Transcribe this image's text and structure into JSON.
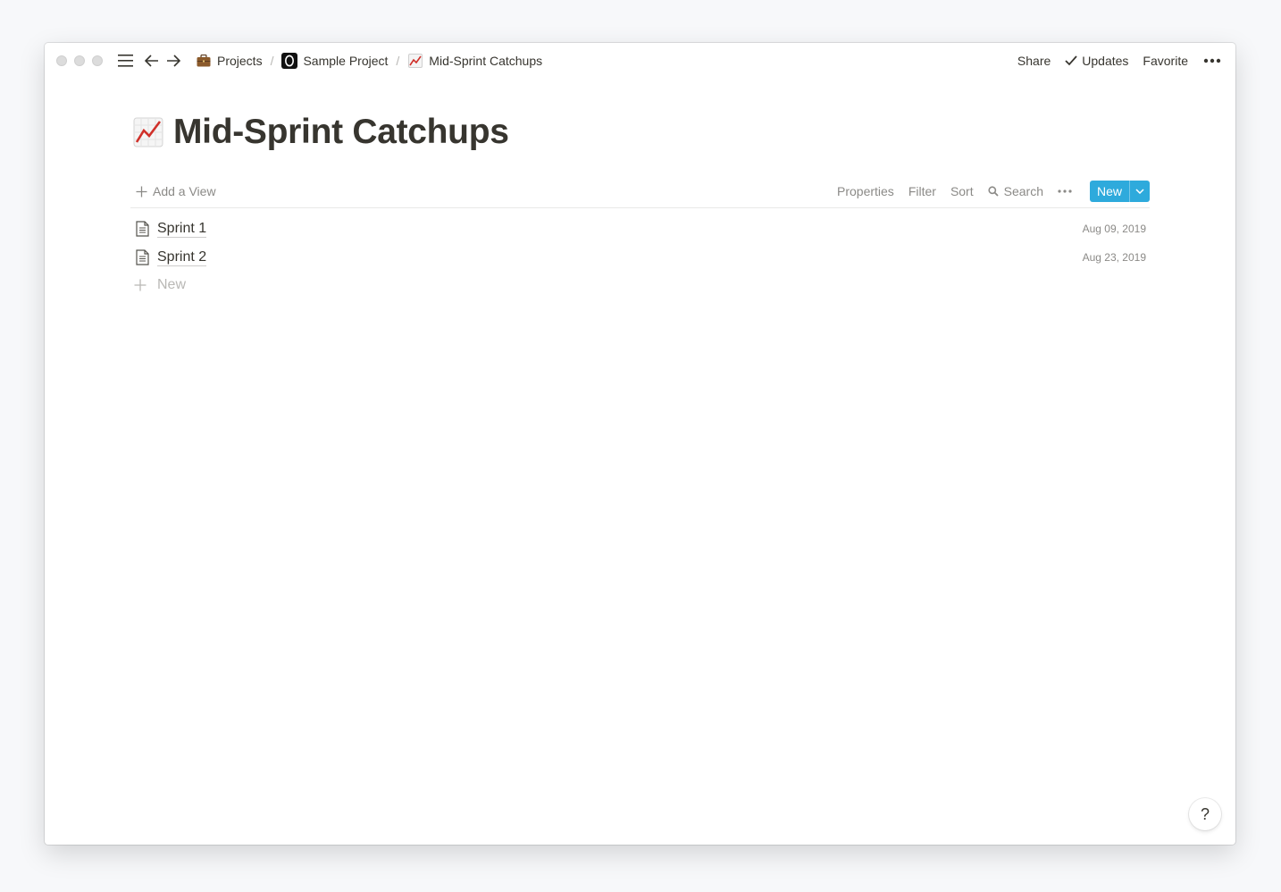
{
  "topbar": {
    "breadcrumb": [
      {
        "icon": "briefcase-icon",
        "label": "Projects"
      },
      {
        "icon": "project-logo-icon",
        "label": "Sample Project"
      },
      {
        "icon": "chart-increasing-icon",
        "label": "Mid-Sprint Catchups"
      }
    ],
    "separator": "/",
    "share_label": "Share",
    "updates_label": "Updates",
    "favorite_label": "Favorite",
    "more_icon": "more-horizontal-icon"
  },
  "page": {
    "title_icon": "chart-increasing-icon",
    "title": "Mid-Sprint Catchups"
  },
  "toolbar": {
    "add_view_label": "Add a View",
    "properties_label": "Properties",
    "filter_label": "Filter",
    "sort_label": "Sort",
    "search_label": "Search",
    "new_label": "New"
  },
  "list": {
    "items": [
      {
        "title": "Sprint 1",
        "date": "Aug 09, 2019"
      },
      {
        "title": "Sprint 2",
        "date": "Aug 23, 2019"
      }
    ],
    "new_label": "New"
  },
  "help": {
    "label": "?"
  },
  "colors": {
    "accent": "#2eaadc",
    "text": "#37352f",
    "muted": "#8b8a87"
  }
}
